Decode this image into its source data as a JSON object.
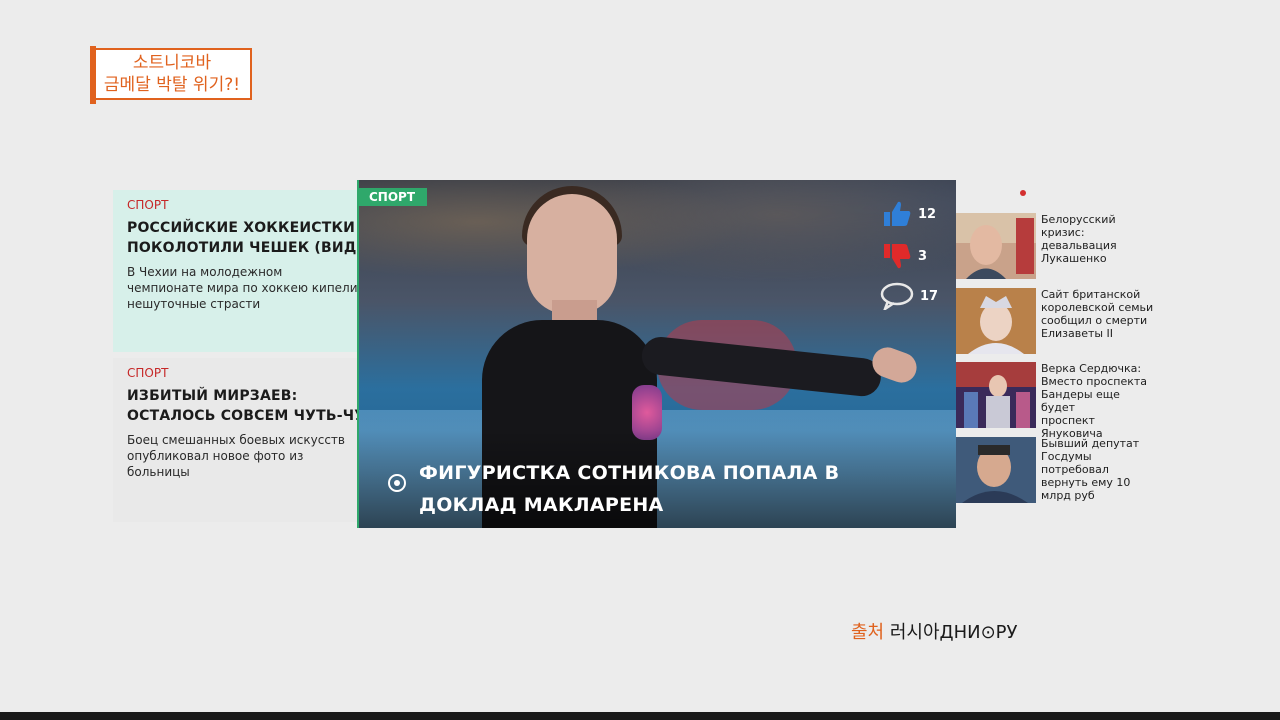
{
  "caption": {
    "line1": "소트니코바",
    "line2": "금메달 박탈 위기?!"
  },
  "left_cards": [
    {
      "tag": "СПОРТ",
      "title_line1": "РОССИЙСКИЕ ХОККЕИСТКИ",
      "title_line2": "ПОКОЛОТИЛИ ЧЕШЕК (ВИДЕО)",
      "desc_line1": "В Чехии на молодежном",
      "desc_line2": "чемпионате мира по хоккею кипели",
      "desc_line3": "нешуточные страсти"
    },
    {
      "tag": "СПОРТ",
      "title_line1": "ИЗБИТЫЙ МИРЗАЕВ:",
      "title_line2": "ОСТАЛОСЬ СОВСЕМ ЧУТЬ-ЧУТЬ",
      "desc_line1": "Боец смешанных боевых искусств",
      "desc_line2": "опубликовал новое фото из",
      "desc_line3": "больницы"
    }
  ],
  "hero": {
    "tag": "СПОРТ",
    "title": "ФИГУРИСТКА СОТНИКОВА ПОПАЛА В ДОКЛАД МАКЛАРЕНА",
    "likes": "12",
    "dislikes": "3",
    "comments": "17"
  },
  "right_news": [
    {
      "l1": "Белорусский",
      "l2": "кризис:",
      "l3": "девальвация",
      "l4": "Лукашенко"
    },
    {
      "l1": "Сайт британской",
      "l2": "королевской семьи",
      "l3": "сообщил о смерти",
      "l4": "Елизаветы II"
    },
    {
      "l1": "Верка Сердючка:",
      "l2": "Вместо проспекта",
      "l3": "Бандеры еще будет",
      "l4": "проспект",
      "l5": "Януковича"
    },
    {
      "l1": "Бывший депутат",
      "l2": "Госдумы",
      "l3": "потребовал",
      "l4": "вернуть ему 10",
      "l5": "млрд руб"
    }
  ],
  "source": {
    "label": "출처",
    "name": "러시아ДНИ⊙РУ"
  },
  "colors": {
    "accent_green": "#2fa86b",
    "tag_red": "#c62828",
    "caption_orange": "#e0621e"
  }
}
